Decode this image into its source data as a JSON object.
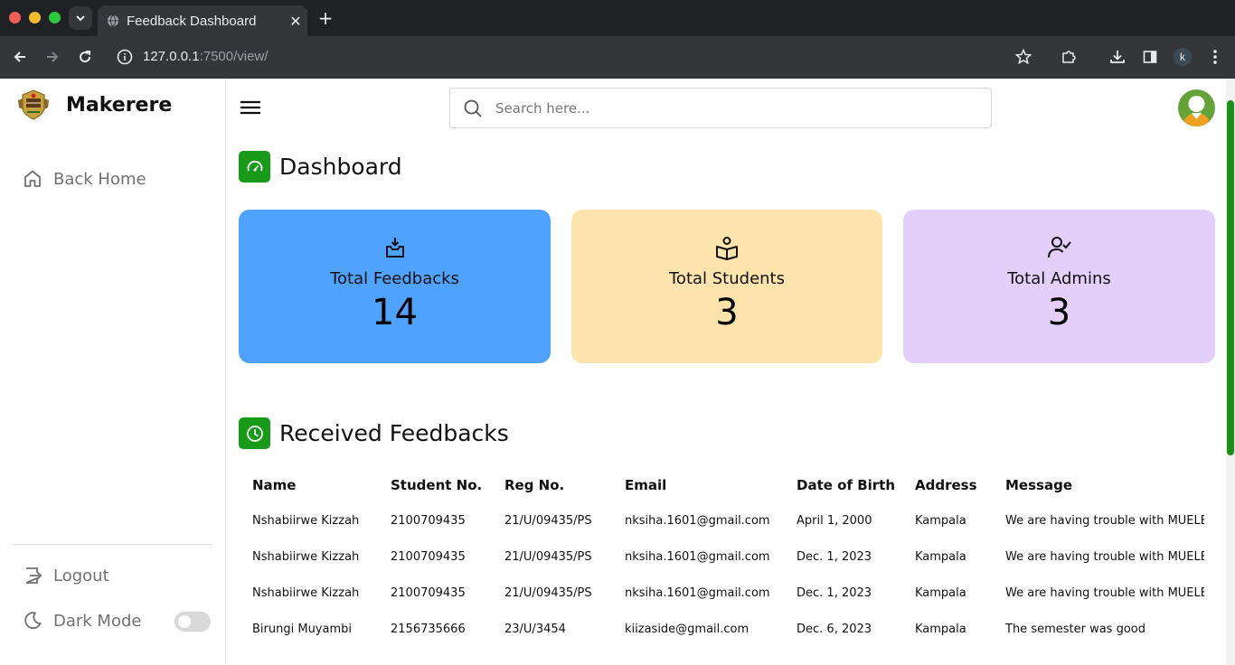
{
  "browser": {
    "tab_title": "Feedback Dashboard",
    "url_host": "127.0.0.1",
    "url_path": ":7500/view/",
    "profile_initial": "k"
  },
  "sidebar": {
    "brand": "Makerere",
    "nav": [
      {
        "label": "Back Home",
        "icon": "home-icon"
      },
      {
        "label": "Logout",
        "icon": "logout-icon"
      },
      {
        "label": "Dark Mode",
        "icon": "moon-icon"
      }
    ],
    "dark_mode_on": false
  },
  "header": {
    "search_placeholder": "Search here..."
  },
  "dashboard": {
    "title": "Dashboard",
    "cards": [
      {
        "label": "Total Feedbacks",
        "value": "14",
        "color": "#4fa3fe"
      },
      {
        "label": "Total Students",
        "value": "3",
        "color": "#fde4ad"
      },
      {
        "label": "Total Admins",
        "value": "3",
        "color": "#e4cffb"
      }
    ]
  },
  "feedbacks": {
    "title": "Received Feedbacks",
    "columns": [
      "Name",
      "Student No.",
      "Reg No.",
      "Email",
      "Date of Birth",
      "Address",
      "Message"
    ],
    "rows": [
      [
        "Nshabiirwe Kizzah",
        "2100709435",
        "21/U/09435/PS",
        "nksiha.1601@gmail.com",
        "April 1, 2000",
        "Kampala",
        "We are having trouble with MUELE"
      ],
      [
        "Nshabiirwe Kizzah",
        "2100709435",
        "21/U/09435/PS",
        "nksiha.1601@gmail.com",
        "Dec. 1, 2023",
        "Kampala",
        "We are having trouble with MUELE"
      ],
      [
        "Nshabiirwe Kizzah",
        "2100709435",
        "21/U/09435/PS",
        "nksiha.1601@gmail.com",
        "Dec. 1, 2023",
        "Kampala",
        "We are having trouble with MUELE"
      ],
      [
        "Birungi Muyambi",
        "2156735666",
        "23/U/3454",
        "kiizaside@gmail.com",
        "Dec. 6, 2023",
        "Kampala",
        "The semester was good"
      ]
    ]
  },
  "colors": {
    "accent_green": "#1a9a1a"
  }
}
